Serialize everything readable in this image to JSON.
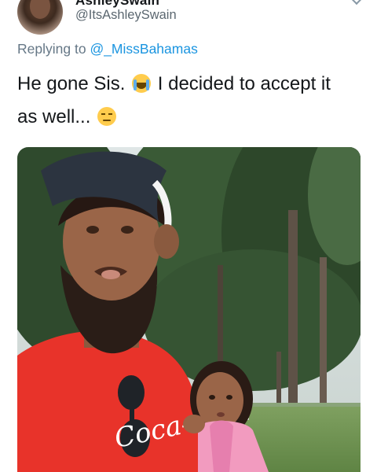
{
  "tweet": {
    "display_name": "AshleySwain",
    "handle": "@ItsAshleySwain",
    "replying_prefix": "Replying to",
    "replying_mention": "@_MissBahamas",
    "text_part1": "He gone Sis.",
    "text_part2": "I decided to accept it",
    "text_part3": "as well...",
    "emoji_1": "loudly-crying-face",
    "emoji_2": "unamused-face"
  },
  "media": {
    "shirt_logo_text": "Coca-Cola"
  },
  "colors": {
    "link": "#1b95e0",
    "secondary_text": "#657786",
    "text": "#14171a",
    "shirt_red": "#e8332a"
  }
}
